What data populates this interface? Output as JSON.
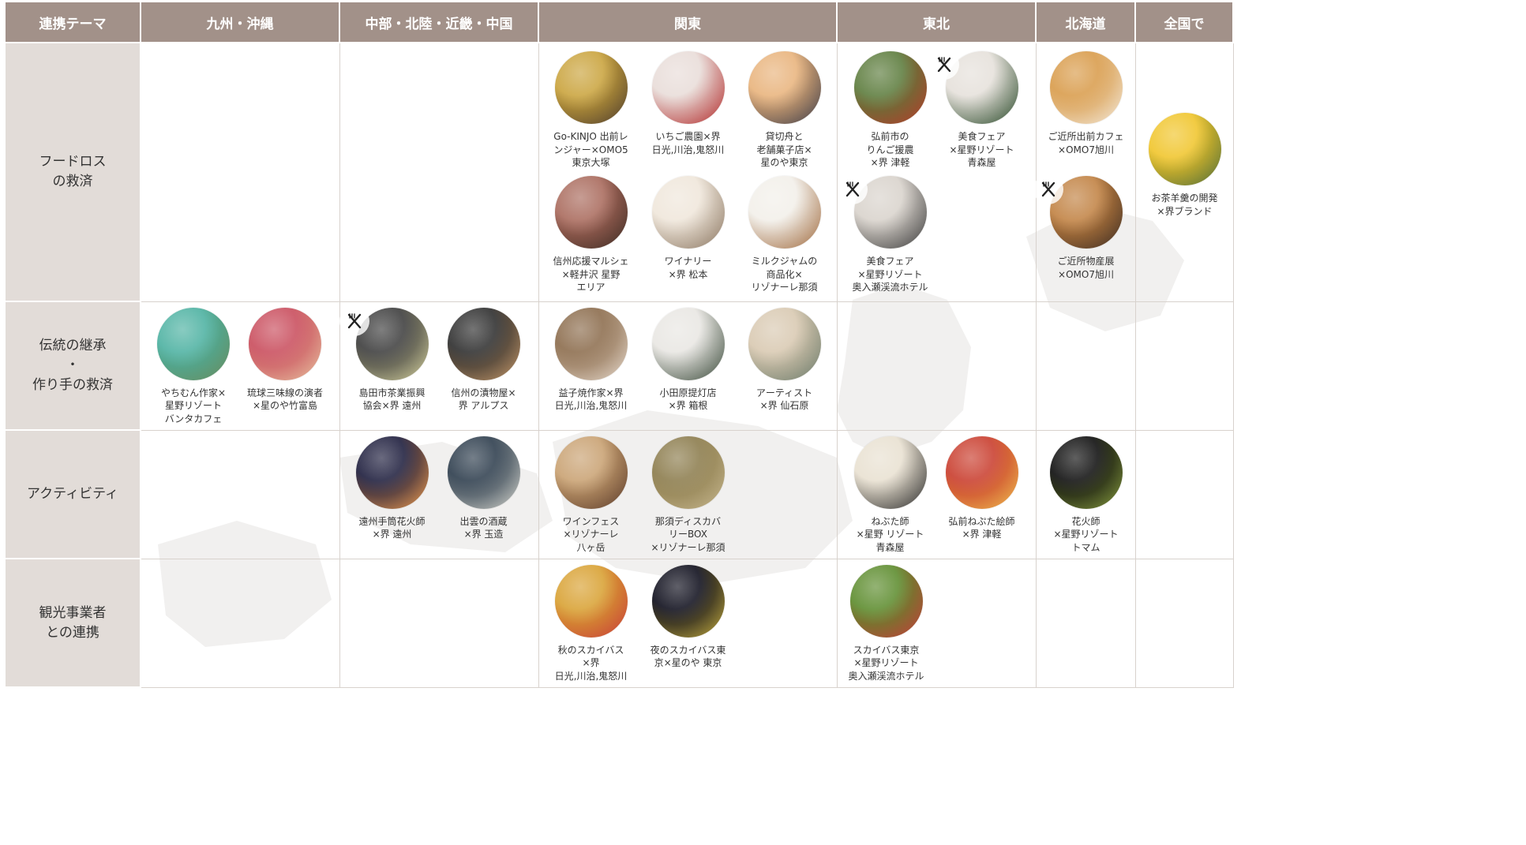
{
  "header": {
    "theme": "連携テーマ",
    "regions": [
      "九州・沖縄",
      "中部・北陸・近畿・中国",
      "関東",
      "東北",
      "北海道",
      "全国で"
    ]
  },
  "rows": [
    {
      "theme": "フードロス\nの救済"
    },
    {
      "theme": "伝統の継承\n・\n作り手の救済"
    },
    {
      "theme": "アクティビティ"
    },
    {
      "theme": "観光事業者\nとの連携"
    }
  ],
  "items": {
    "food_kanto_1": {
      "caption": "Go-KINJO 出前レ\nンジャー×OMO5\n東京大塚",
      "photo_colors": [
        "#c9a23a",
        "#4a3a2e"
      ]
    },
    "food_kanto_2": {
      "caption": "いちご農園×界\n日光,川治,鬼怒川",
      "photo_colors": [
        "#e8dcd8",
        "#b22a2a"
      ]
    },
    "food_kanto_3": {
      "caption": "貸切舟と\n老舗菓子店×\n星のや東京",
      "photo_colors": [
        "#e8b27a",
        "#3a3a48"
      ]
    },
    "food_kanto_4": {
      "caption": "信州応援マルシェ\n×軽井沢 星野\nエリア",
      "photo_colors": [
        "#a8685a",
        "#3a2a22"
      ]
    },
    "food_kanto_5": {
      "caption": "ワイナリー\n×界 松本",
      "photo_colors": [
        "#efe6da",
        "#8a7560"
      ]
    },
    "food_kanto_6": {
      "caption": "ミルクジャムの\n商品化×\nリゾナーレ那須",
      "photo_colors": [
        "#f2efe9",
        "#a06a3e"
      ]
    },
    "food_tohoku_1": {
      "caption": "弘前市の\nりんご援農\n×界 津軽",
      "photo_colors": [
        "#5a7a3a",
        "#b83a2a"
      ]
    },
    "food_tohoku_2": {
      "caption": "美食フェア\n×星野リゾート\n青森屋",
      "photo_colors": [
        "#e5e0da",
        "#2a4a2a"
      ]
    },
    "food_tohoku_3": {
      "caption": "美食フェア\n×星野リゾート\n奥入瀬渓流ホテル",
      "photo_colors": [
        "#d8d2cb",
        "#3a3a3a"
      ]
    },
    "food_hokkaido_1": {
      "caption": "ご近所出前カフェ\n×OMO7旭川",
      "photo_colors": [
        "#d89a48",
        "#f4ece0"
      ]
    },
    "food_hokkaido_2": {
      "caption": "ご近所物産展\n×OMO7旭川",
      "photo_colors": [
        "#c08040",
        "#3a2a22"
      ]
    },
    "food_national_1": {
      "caption": "お茶羊羹の開発\n×界ブランド",
      "photo_colors": [
        "#f0c428",
        "#4a6a3a"
      ]
    },
    "trad_kyushu_1": {
      "caption": "やちむん作家×\n星野リゾート\nバンタカフェ",
      "photo_colors": [
        "#4ab0a0",
        "#6a8a5a"
      ]
    },
    "trad_kyushu_2": {
      "caption": "琉球三味線の演者\n×星のや竹富島",
      "photo_colors": [
        "#c84a5a",
        "#e8c4a0"
      ]
    },
    "trad_chubu_1": {
      "caption": "島田市茶業振興\n協会×界 遠州",
      "photo_colors": [
        "#3a3a3a",
        "#d8d4a0"
      ]
    },
    "trad_chubu_2": {
      "caption": "信州の漬物屋×\n界 アルプス",
      "photo_colors": [
        "#2a2a2a",
        "#c89a6a"
      ]
    },
    "trad_kanto_1": {
      "caption": "益子焼作家×界\n日光,川治,鬼怒川",
      "photo_colors": [
        "#8a6a4a",
        "#e8dcd0"
      ]
    },
    "trad_kanto_2": {
      "caption": "小田原提灯店\n×界 箱根",
      "photo_colors": [
        "#e8e6e2",
        "#3a4a3a"
      ]
    },
    "trad_kanto_3": {
      "caption": "アーティスト\n×界 仙石原",
      "photo_colors": [
        "#d8c8b0",
        "#6a7a6a"
      ]
    },
    "act_chubu_1": {
      "caption": "遠州手筒花火師\n×界 遠州",
      "photo_colors": [
        "#1a1a3a",
        "#f4a050"
      ]
    },
    "act_chubu_2": {
      "caption": "出雲の酒蔵\n×界 玉造",
      "photo_colors": [
        "#2a3a4a",
        "#d8d8d0"
      ]
    },
    "act_kanto_1": {
      "caption": "ワインフェス\n×リゾナーレ\n八ヶ岳",
      "photo_colors": [
        "#c8a070",
        "#5a3a2a"
      ]
    },
    "act_kanto_2": {
      "caption": "那須ディスカバ\nリーBOX\n×リゾナーレ那須",
      "photo_colors": [
        "#8a7a4a",
        "#c8b890"
      ]
    },
    "act_tohoku_1": {
      "caption": "ねぶた師\n×星野 リゾート\n青森屋",
      "photo_colors": [
        "#e8e0d0",
        "#2a2a2a"
      ]
    },
    "act_tohoku_2": {
      "caption": "弘前ねぷた絵師\n×界 津軽",
      "photo_colors": [
        "#c83a2a",
        "#f0c050"
      ]
    },
    "act_hokkaido_1": {
      "caption": "花火師\n×星野リゾート\nトマム",
      "photo_colors": [
        "#0a0a0a",
        "#8aa040"
      ]
    },
    "tour_kanto_1": {
      "caption": "秋のスカイバス\n×界\n日光,川治,鬼怒川",
      "photo_colors": [
        "#d8a030",
        "#c83a3a"
      ]
    },
    "tour_kanto_2": {
      "caption": "夜のスカイバス東\n京×星のや 東京",
      "photo_colors": [
        "#0a0a18",
        "#c8b040"
      ]
    },
    "tour_tohoku_1": {
      "caption": "スカイバス東京\n×星野リゾート\n奥入瀬渓流ホテル",
      "photo_colors": [
        "#5a8a2a",
        "#c83a3a"
      ]
    }
  }
}
